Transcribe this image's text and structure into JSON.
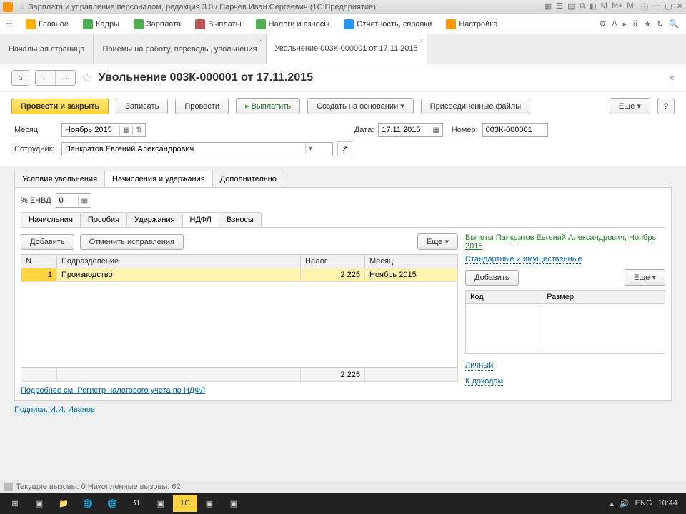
{
  "titlebar": {
    "title": "Зарплата и управление персоналом, редакция 3.0 / Парчев Иван Сергеевич  (1С:Предприятие)"
  },
  "menu": {
    "items": [
      "Главное",
      "Кадры",
      "Зарплата",
      "Выплаты",
      "Налоги и взносы",
      "Отчетность, справки",
      "Настройка"
    ]
  },
  "tabs": {
    "items": [
      {
        "label": "Начальная страница"
      },
      {
        "label": "Приемы на работу, переводы, увольнения"
      },
      {
        "label": "Увольнение 003К-000001 от 17.11.2015"
      }
    ]
  },
  "page": {
    "title": "Увольнение 003К-000001 от 17.11.2015",
    "buttons": {
      "post_close": "Провести и закрыть",
      "write": "Записать",
      "post": "Провести",
      "pay": "Выплатить",
      "create_based": "Создать на основании",
      "attached": "Присоединенные файлы",
      "more": "Еще"
    }
  },
  "form": {
    "month_label": "Месяц:",
    "month_value": "Ноябрь 2015",
    "date_label": "Дата:",
    "date_value": "17.11.2015",
    "number_label": "Номер:",
    "number_value": "003К-000001",
    "employee_label": "Сотрудник:",
    "employee_value": "Панкратов Евгений Александрович",
    "envd_label": "% ЕНВД",
    "envd_value": "0"
  },
  "inner_tabs": [
    "Условия увольнения",
    "Начисления и удержания",
    "Дополнительно"
  ],
  "sub_tabs": [
    "Начисления",
    "Пособия",
    "Удержания",
    "НДФЛ",
    "Взносы"
  ],
  "table": {
    "btn_add": "Добавить",
    "btn_cancel": "Отменить исправления",
    "btn_more": "Еще",
    "cols": {
      "n": "N",
      "dept": "Подразделение",
      "tax": "Налог",
      "month": "Месяц"
    },
    "row": {
      "n": "1",
      "dept": "Производство",
      "tax": "2 225",
      "month": "Ноябрь 2015"
    },
    "footer_tax": "2 225",
    "detail_link": "Подробнее см. Регистр налогового учета по НДФЛ"
  },
  "rightpanel": {
    "title": "Вычеты Панкратов Евгений Александрович, Ноябрь 2015",
    "standard_link": "Стандартные и имущественные",
    "btn_add": "Добавить",
    "btn_more": "Еще",
    "col_code": "Код",
    "col_size": "Размер",
    "personal_link": "Личный",
    "income_link": "К доходам"
  },
  "signatures": "Подписи: И.И. Иванов",
  "status": "Текущие вызовы: 0   Накопленные вызовы: 62",
  "tray": {
    "lang": "ENG",
    "time": "10:44"
  }
}
